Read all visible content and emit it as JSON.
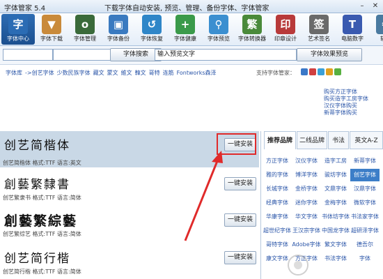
{
  "window": {
    "title": "字体管家 5.4",
    "tagline": "下载字体自动安装, 预览、管理、备份字体、字体管家",
    "minimize": "–",
    "close": "✕"
  },
  "toolbar": [
    {
      "label": "字体中心",
      "icon": "font-center-icon",
      "glyph": "字",
      "color": "#2b6cb4"
    },
    {
      "label": "字体下载",
      "icon": "download-icon",
      "glyph": "▼",
      "color": "#c98a3a"
    },
    {
      "label": "字体管理",
      "icon": "manage-icon",
      "glyph": "o",
      "color": "#3a6a3a"
    },
    {
      "label": "字体备份",
      "icon": "backup-icon",
      "glyph": "▣",
      "color": "#3a7ac0"
    },
    {
      "label": "字体恢复",
      "icon": "restore-icon",
      "glyph": "↺",
      "color": "#2f86c8"
    },
    {
      "label": "字体健康",
      "icon": "health-icon",
      "glyph": "+",
      "color": "#3a9a4a"
    },
    {
      "label": "字体预览",
      "icon": "preview-icon",
      "glyph": "⚲",
      "color": "#3b8fd0"
    },
    {
      "label": "字体转换器",
      "icon": "converter-icon",
      "glyph": "繁",
      "color": "#4a8a3a"
    },
    {
      "label": "印章设计",
      "icon": "seal-icon",
      "glyph": "印",
      "color": "#b83a3a"
    },
    {
      "label": "艺术签名",
      "icon": "signature-icon",
      "glyph": "签",
      "color": "#6a6a6a"
    },
    {
      "label": "电脑数字",
      "icon": "digital-icon",
      "glyph": "T",
      "color": "#3a5ab0"
    },
    {
      "label": "软件",
      "icon": "software-icon",
      "glyph": "⚙",
      "color": "#4a7aa0"
    }
  ],
  "search": {
    "button": "字体搜索",
    "preview_text": "输入预览文字",
    "preview_button": "字体效果预览"
  },
  "breadcrumb": [
    "字体库",
    "->创艺字体",
    "少数民族字体",
    "藏文",
    "蒙文",
    "維文",
    "韓文",
    "哥特",
    "连筋",
    "Fontworks森泽"
  ],
  "support_label": "支持字体管家：",
  "buy_links": [
    "购买方正字体",
    "购买造字工房字体",
    "汉仪字体购买",
    "新蒂字体购买"
  ],
  "fonts": [
    {
      "sample": "创艺简楷体",
      "meta": "创艺简楷体 格式:TTF 语言:英文",
      "install": "一键安装"
    },
    {
      "sample": "創藝繁隸書",
      "meta": "创艺繁隶书 格式:TTF 语言:简体",
      "install": "一键安装"
    },
    {
      "sample": "創藝繁綜藝",
      "meta": "创艺繁综艺 格式:TTF 语言:简体",
      "install": "一键安装"
    },
    {
      "sample": "创艺简行楷",
      "meta": "创艺简行楷 格式:TTF 语言:简体",
      "install": "一键安装"
    }
  ],
  "tabs": [
    "推荐品牌",
    "二线品牌",
    "书法",
    "英文A-Z"
  ],
  "brands": [
    "方正字体",
    "汉仪字体",
    "造字工房",
    "新蒂字体",
    "雅的字体",
    "博洋字体",
    "骏坊字体",
    "创艺字体",
    "长城字体",
    "金桥字体",
    "文鼎字体",
    "汉鼎字体",
    "经典字体",
    "迷你字体",
    "金梅字体",
    "微软字体",
    "华康字体",
    "华文字体",
    "书体坊字体",
    "书法家字体",
    "超世纪字体",
    "王汉宗字体",
    "中国龙字体",
    "超研泽字体",
    "哥特字体",
    "Adobe字体",
    "繁文字体",
    "德吾尔",
    "康文字体",
    "方正字体",
    "书法字体",
    "字体"
  ],
  "colors": {
    "accent": "#2b6cb4",
    "highlight": "#e02a2a",
    "selected_row": "#c9d8e6"
  }
}
